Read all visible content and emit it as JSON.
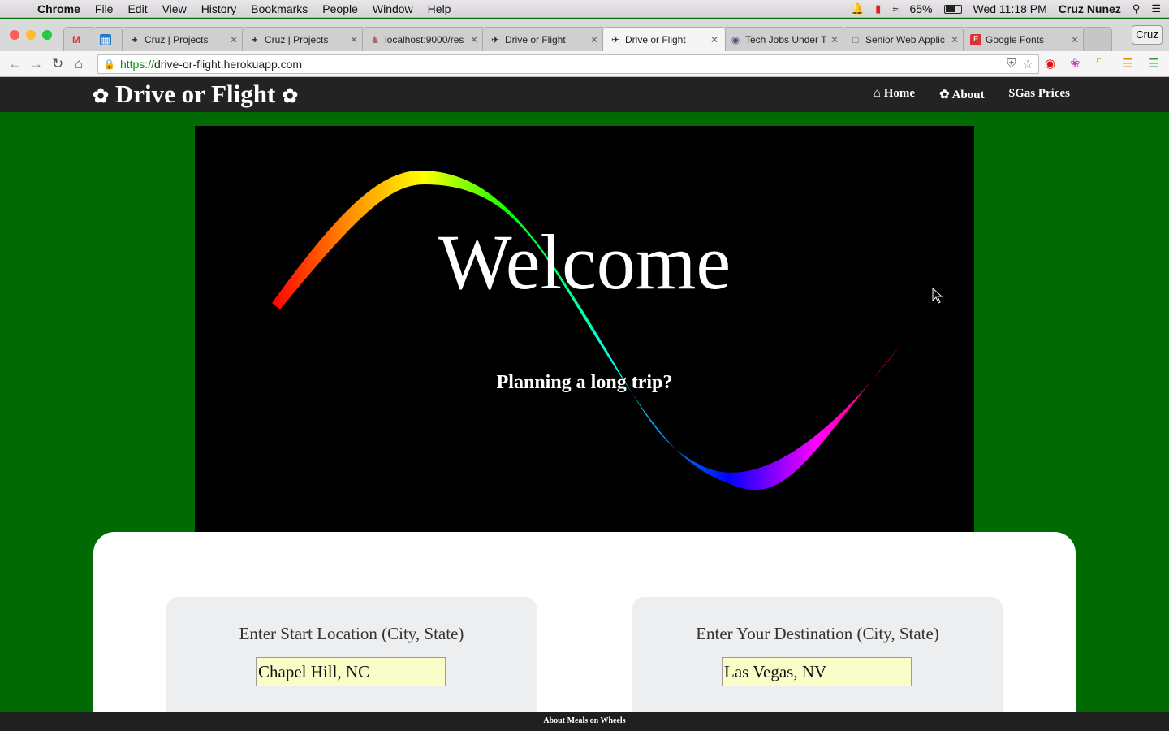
{
  "menubar": {
    "app_name": "Chrome",
    "menus": [
      "File",
      "Edit",
      "View",
      "History",
      "Bookmarks",
      "People",
      "Window",
      "Help"
    ],
    "battery": "65%",
    "clock": "Wed 11:18 PM",
    "user": "Cruz Nunez"
  },
  "tabs": [
    {
      "label": "",
      "icon": "gmail-icon"
    },
    {
      "label": "",
      "icon": "trello-icon"
    },
    {
      "label": "Cruz | Projects",
      "icon": "plus-icon"
    },
    {
      "label": "Cruz | Projects",
      "icon": "plus-icon"
    },
    {
      "label": "localhost:9000/res",
      "icon": "dog-icon"
    },
    {
      "label": "Drive or Flight",
      "icon": "plane-icon"
    },
    {
      "label": "Drive or Flight",
      "icon": "plane-icon",
      "active": true
    },
    {
      "label": "Tech Jobs Under T",
      "icon": "globe-icon"
    },
    {
      "label": "Senior Web Applic",
      "icon": "doc-icon"
    },
    {
      "label": "Google Fonts",
      "icon": "google-fonts-icon"
    }
  ],
  "profile_button": "Cruz",
  "address": {
    "scheme": "https://",
    "host": "drive-or-flight.herokuapp.com"
  },
  "site": {
    "brand": "Drive or Flight",
    "nav": {
      "home": "Home",
      "about": "About",
      "gas_prices": "Gas Prices"
    }
  },
  "hero": {
    "title": "Welcome",
    "subtitle": "Planning a long trip?"
  },
  "form": {
    "start_label": "Enter Start Location (City, State)",
    "start_value": "Chapel Hill, NC",
    "dest_label": "Enter Your Destination (City, State)",
    "dest_value": "Las Vegas, NV"
  },
  "footer": {
    "text": "About Meals on Wheels"
  },
  "colors": {
    "page_background": "#016a03",
    "navbar": "#232323",
    "input_background": "#fbfdc8"
  }
}
